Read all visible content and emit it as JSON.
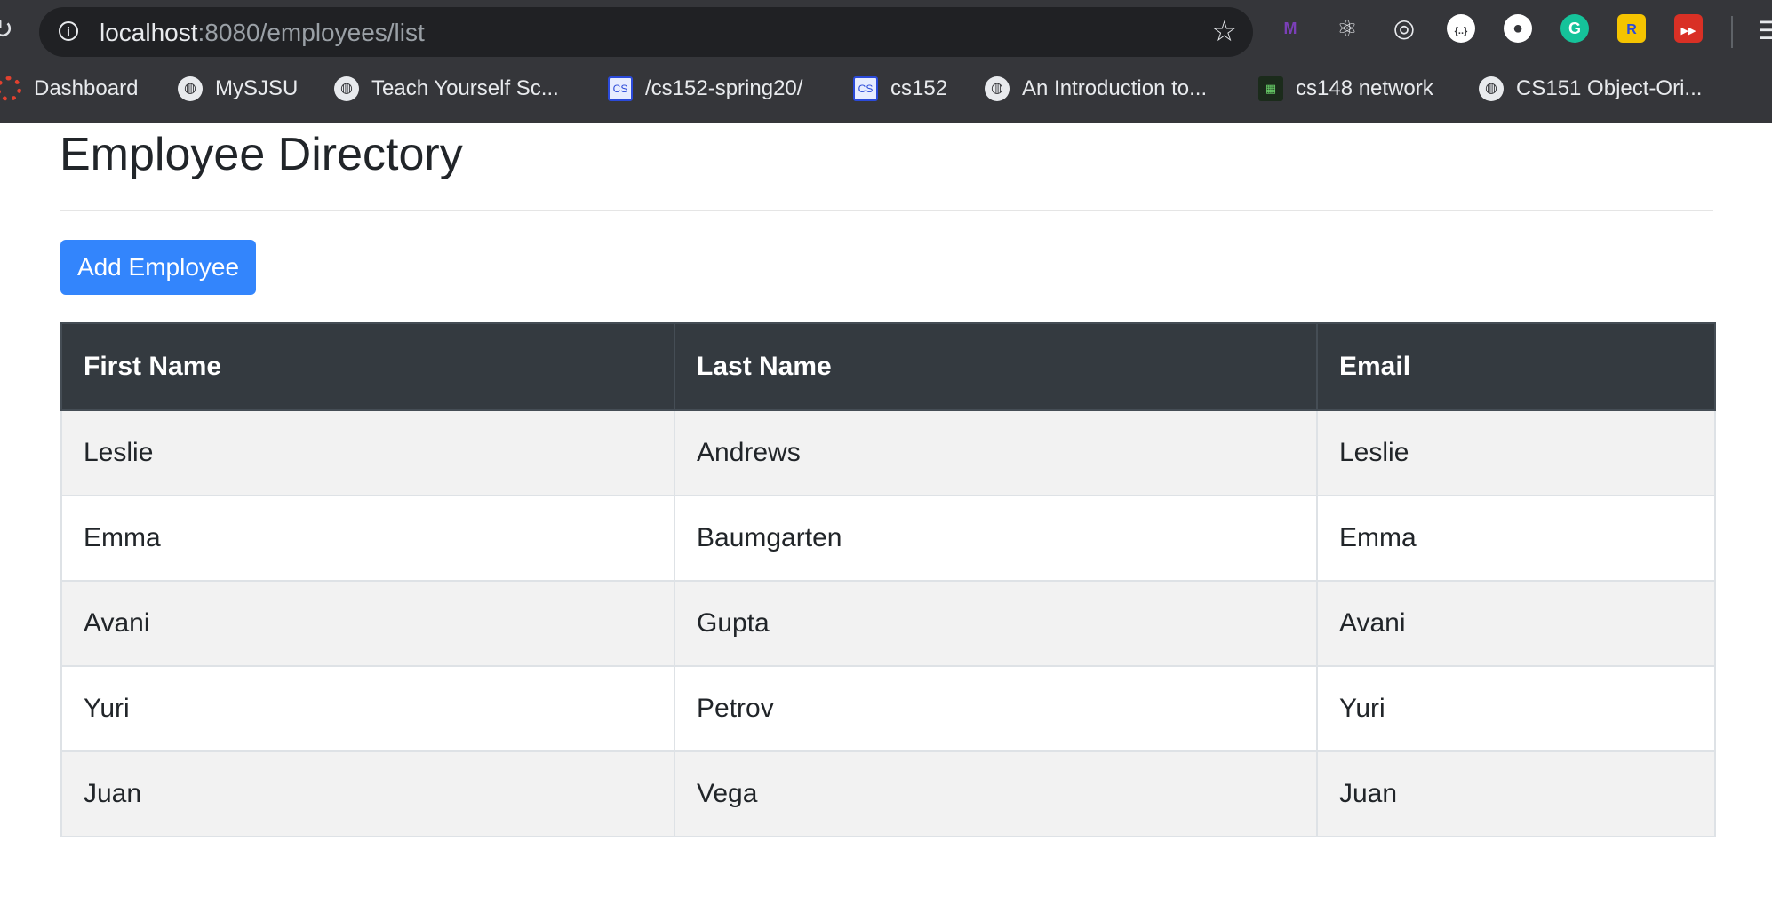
{
  "browser": {
    "url_host": "localhost",
    "url_path": ":8080/employees/list",
    "extensions": [
      {
        "name": "m-extension-icon",
        "glyph": "M",
        "color": "#5b2a86"
      },
      {
        "name": "react-devtools-icon",
        "glyph": "⚛",
        "color": "#35363a"
      },
      {
        "name": "target-extension-icon",
        "glyph": "◎",
        "color": "#35363a"
      },
      {
        "name": "json-viewer-icon",
        "glyph": "{..}",
        "color": "#ffffff"
      },
      {
        "name": "github-icon",
        "glyph": "●",
        "color": "#35363a"
      },
      {
        "name": "grammarly-icon",
        "glyph": "G",
        "color": "#15c39a"
      },
      {
        "name": "redux-devtools-icon",
        "glyph": "R",
        "color": "#f5c400"
      },
      {
        "name": "video-extension-icon",
        "glyph": "▶▶",
        "color": "#d93025"
      }
    ],
    "bookmarks": [
      {
        "label": "Dashboard",
        "icon": "canvas-icon"
      },
      {
        "label": "MySJSU",
        "icon": "globe-icon"
      },
      {
        "label": "Teach Yourself Sc...",
        "icon": "globe-icon"
      },
      {
        "label": "/cs152-spring20/",
        "icon": "cs-square-icon"
      },
      {
        "label": "cs152",
        "icon": "cs-square-icon"
      },
      {
        "label": "An Introduction to...",
        "icon": "globe-icon"
      },
      {
        "label": "cs148 network",
        "icon": "grid-icon"
      },
      {
        "label": "CS151 Object-Ori...",
        "icon": "globe-icon"
      }
    ]
  },
  "page": {
    "title": "Employee Directory",
    "add_button_label": "Add Employee"
  },
  "table": {
    "headers": [
      "First Name",
      "Last Name",
      "Email"
    ],
    "rows": [
      [
        "Leslie",
        "Andrews",
        "Leslie"
      ],
      [
        "Emma",
        "Baumgarten",
        "Emma"
      ],
      [
        "Avani",
        "Gupta",
        "Avani"
      ],
      [
        "Yuri",
        "Petrov",
        "Yuri"
      ],
      [
        "Juan",
        "Vega",
        "Juan"
      ]
    ]
  }
}
